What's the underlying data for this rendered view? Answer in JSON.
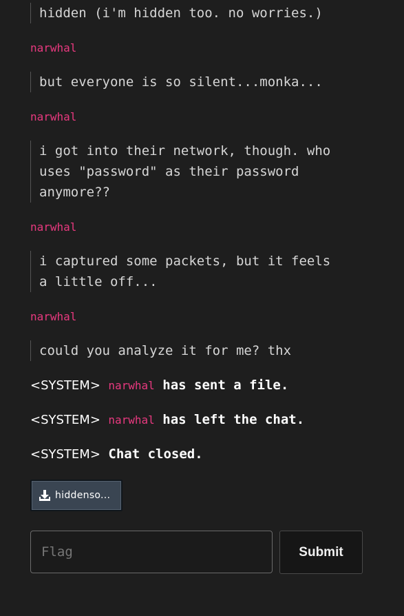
{
  "messages": [
    {
      "type": "text",
      "text": "hidden (i'm hidden too. no worries.)"
    },
    {
      "type": "sender",
      "name": "narwhal"
    },
    {
      "type": "text",
      "text": "but everyone is so silent...monka..."
    },
    {
      "type": "sender",
      "name": "narwhal"
    },
    {
      "type": "text",
      "text": "i got into their network, though. who\nuses \"password\" as their password\nanymore??"
    },
    {
      "type": "sender",
      "name": "narwhal"
    },
    {
      "type": "text",
      "text": "i captured some packets, but it feels\na little off..."
    },
    {
      "type": "sender",
      "name": "narwhal"
    },
    {
      "type": "text",
      "text": "could you analyze it for me? thx"
    }
  ],
  "system": [
    {
      "tag": "<SYSTEM>",
      "who": "narwhal",
      "text": "has sent a file."
    },
    {
      "tag": "<SYSTEM>",
      "who": "narwhal",
      "text": "has left the chat."
    },
    {
      "tag": "<SYSTEM>",
      "who": "",
      "text": "Chat closed."
    }
  ],
  "file": {
    "name": "hiddenso...",
    "icon": "download-icon"
  },
  "form": {
    "flag_placeholder": "Flag",
    "flag_value": "",
    "submit_label": "Submit"
  },
  "colors": {
    "background": "#1e1e1e",
    "sender": "#e8397f",
    "text": "#d6d6d6",
    "file_button": "#3a4552"
  }
}
